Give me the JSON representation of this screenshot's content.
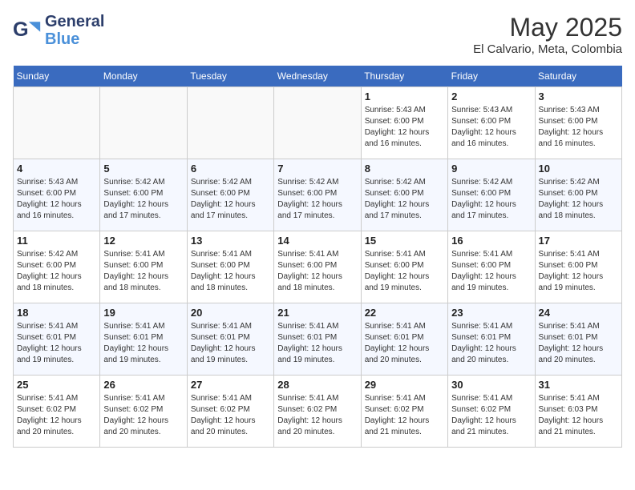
{
  "header": {
    "logo_line1": "General",
    "logo_line2": "Blue",
    "month": "May 2025",
    "location": "El Calvario, Meta, Colombia"
  },
  "days_of_week": [
    "Sunday",
    "Monday",
    "Tuesday",
    "Wednesday",
    "Thursday",
    "Friday",
    "Saturday"
  ],
  "weeks": [
    [
      {
        "day": "",
        "info": ""
      },
      {
        "day": "",
        "info": ""
      },
      {
        "day": "",
        "info": ""
      },
      {
        "day": "",
        "info": ""
      },
      {
        "day": "1",
        "info": "Sunrise: 5:43 AM\nSunset: 6:00 PM\nDaylight: 12 hours\nand 16 minutes."
      },
      {
        "day": "2",
        "info": "Sunrise: 5:43 AM\nSunset: 6:00 PM\nDaylight: 12 hours\nand 16 minutes."
      },
      {
        "day": "3",
        "info": "Sunrise: 5:43 AM\nSunset: 6:00 PM\nDaylight: 12 hours\nand 16 minutes."
      }
    ],
    [
      {
        "day": "4",
        "info": "Sunrise: 5:43 AM\nSunset: 6:00 PM\nDaylight: 12 hours\nand 16 minutes."
      },
      {
        "day": "5",
        "info": "Sunrise: 5:42 AM\nSunset: 6:00 PM\nDaylight: 12 hours\nand 17 minutes."
      },
      {
        "day": "6",
        "info": "Sunrise: 5:42 AM\nSunset: 6:00 PM\nDaylight: 12 hours\nand 17 minutes."
      },
      {
        "day": "7",
        "info": "Sunrise: 5:42 AM\nSunset: 6:00 PM\nDaylight: 12 hours\nand 17 minutes."
      },
      {
        "day": "8",
        "info": "Sunrise: 5:42 AM\nSunset: 6:00 PM\nDaylight: 12 hours\nand 17 minutes."
      },
      {
        "day": "9",
        "info": "Sunrise: 5:42 AM\nSunset: 6:00 PM\nDaylight: 12 hours\nand 17 minutes."
      },
      {
        "day": "10",
        "info": "Sunrise: 5:42 AM\nSunset: 6:00 PM\nDaylight: 12 hours\nand 18 minutes."
      }
    ],
    [
      {
        "day": "11",
        "info": "Sunrise: 5:42 AM\nSunset: 6:00 PM\nDaylight: 12 hours\nand 18 minutes."
      },
      {
        "day": "12",
        "info": "Sunrise: 5:41 AM\nSunset: 6:00 PM\nDaylight: 12 hours\nand 18 minutes."
      },
      {
        "day": "13",
        "info": "Sunrise: 5:41 AM\nSunset: 6:00 PM\nDaylight: 12 hours\nand 18 minutes."
      },
      {
        "day": "14",
        "info": "Sunrise: 5:41 AM\nSunset: 6:00 PM\nDaylight: 12 hours\nand 18 minutes."
      },
      {
        "day": "15",
        "info": "Sunrise: 5:41 AM\nSunset: 6:00 PM\nDaylight: 12 hours\nand 19 minutes."
      },
      {
        "day": "16",
        "info": "Sunrise: 5:41 AM\nSunset: 6:00 PM\nDaylight: 12 hours\nand 19 minutes."
      },
      {
        "day": "17",
        "info": "Sunrise: 5:41 AM\nSunset: 6:00 PM\nDaylight: 12 hours\nand 19 minutes."
      }
    ],
    [
      {
        "day": "18",
        "info": "Sunrise: 5:41 AM\nSunset: 6:01 PM\nDaylight: 12 hours\nand 19 minutes."
      },
      {
        "day": "19",
        "info": "Sunrise: 5:41 AM\nSunset: 6:01 PM\nDaylight: 12 hours\nand 19 minutes."
      },
      {
        "day": "20",
        "info": "Sunrise: 5:41 AM\nSunset: 6:01 PM\nDaylight: 12 hours\nand 19 minutes."
      },
      {
        "day": "21",
        "info": "Sunrise: 5:41 AM\nSunset: 6:01 PM\nDaylight: 12 hours\nand 19 minutes."
      },
      {
        "day": "22",
        "info": "Sunrise: 5:41 AM\nSunset: 6:01 PM\nDaylight: 12 hours\nand 20 minutes."
      },
      {
        "day": "23",
        "info": "Sunrise: 5:41 AM\nSunset: 6:01 PM\nDaylight: 12 hours\nand 20 minutes."
      },
      {
        "day": "24",
        "info": "Sunrise: 5:41 AM\nSunset: 6:01 PM\nDaylight: 12 hours\nand 20 minutes."
      }
    ],
    [
      {
        "day": "25",
        "info": "Sunrise: 5:41 AM\nSunset: 6:02 PM\nDaylight: 12 hours\nand 20 minutes."
      },
      {
        "day": "26",
        "info": "Sunrise: 5:41 AM\nSunset: 6:02 PM\nDaylight: 12 hours\nand 20 minutes."
      },
      {
        "day": "27",
        "info": "Sunrise: 5:41 AM\nSunset: 6:02 PM\nDaylight: 12 hours\nand 20 minutes."
      },
      {
        "day": "28",
        "info": "Sunrise: 5:41 AM\nSunset: 6:02 PM\nDaylight: 12 hours\nand 20 minutes."
      },
      {
        "day": "29",
        "info": "Sunrise: 5:41 AM\nSunset: 6:02 PM\nDaylight: 12 hours\nand 21 minutes."
      },
      {
        "day": "30",
        "info": "Sunrise: 5:41 AM\nSunset: 6:02 PM\nDaylight: 12 hours\nand 21 minutes."
      },
      {
        "day": "31",
        "info": "Sunrise: 5:41 AM\nSunset: 6:03 PM\nDaylight: 12 hours\nand 21 minutes."
      }
    ]
  ]
}
